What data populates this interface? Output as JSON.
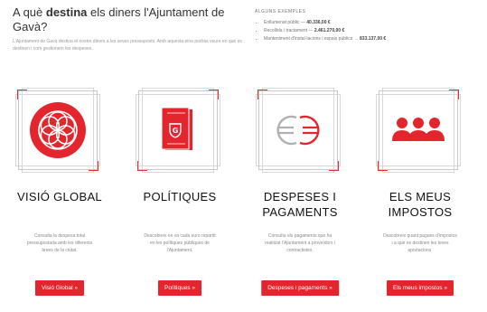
{
  "header": {
    "title_prefix": "A què ",
    "title_bold": "destina",
    "title_suffix": " els diners l'Ajuntament de Gavà?",
    "description": "L'Ajuntament de Gavà destina el nostre diners a les seves pressuposts. Amb aquesta eina podràs veure en què es destinen i com gestionem les despeses."
  },
  "facts": {
    "title": "Alguns exemples",
    "items": [
      {
        "text": "Enllumenat públic — ",
        "bold": "40.336,00 €"
      },
      {
        "text": "Recollida i tractament — ",
        "bold": "2.461.270,00 €"
      },
      {
        "text": "Manteniment d'instal·lacions i espais públics → ",
        "bold": "833.137,00 €"
      }
    ]
  },
  "cards": [
    {
      "icon": "globe-flower-icon",
      "title": "VISIÓ GLOBAL",
      "description": "Consulta la despesa total pressupostada amb les diferents àrees de la ciutat.",
      "button": "Visió Global »"
    },
    {
      "icon": "book-icon",
      "title": "POLÍTIQUES",
      "description": "Descobreix on va cada euro repartit en les polítiques públiques de l'Ajuntament.",
      "button": "Polítiques »"
    },
    {
      "icon": "euro-icon",
      "title": "DESPESES I PAGAMENTS",
      "description": "Consulta els pagaments que ha realitzat l'Ajuntament a proveïdors i contractistes.",
      "button": "Despeses i pagaments »"
    },
    {
      "icon": "people-icon",
      "title": "ELS MEUS IMPOSTOS",
      "description": "Descobreix quant pagues d'impostos i a què es destinen les teves aportacions.",
      "button": "Els meus impostos »"
    }
  ],
  "colors": {
    "accent": "#e3262d",
    "frame": "#c9c9c9"
  }
}
